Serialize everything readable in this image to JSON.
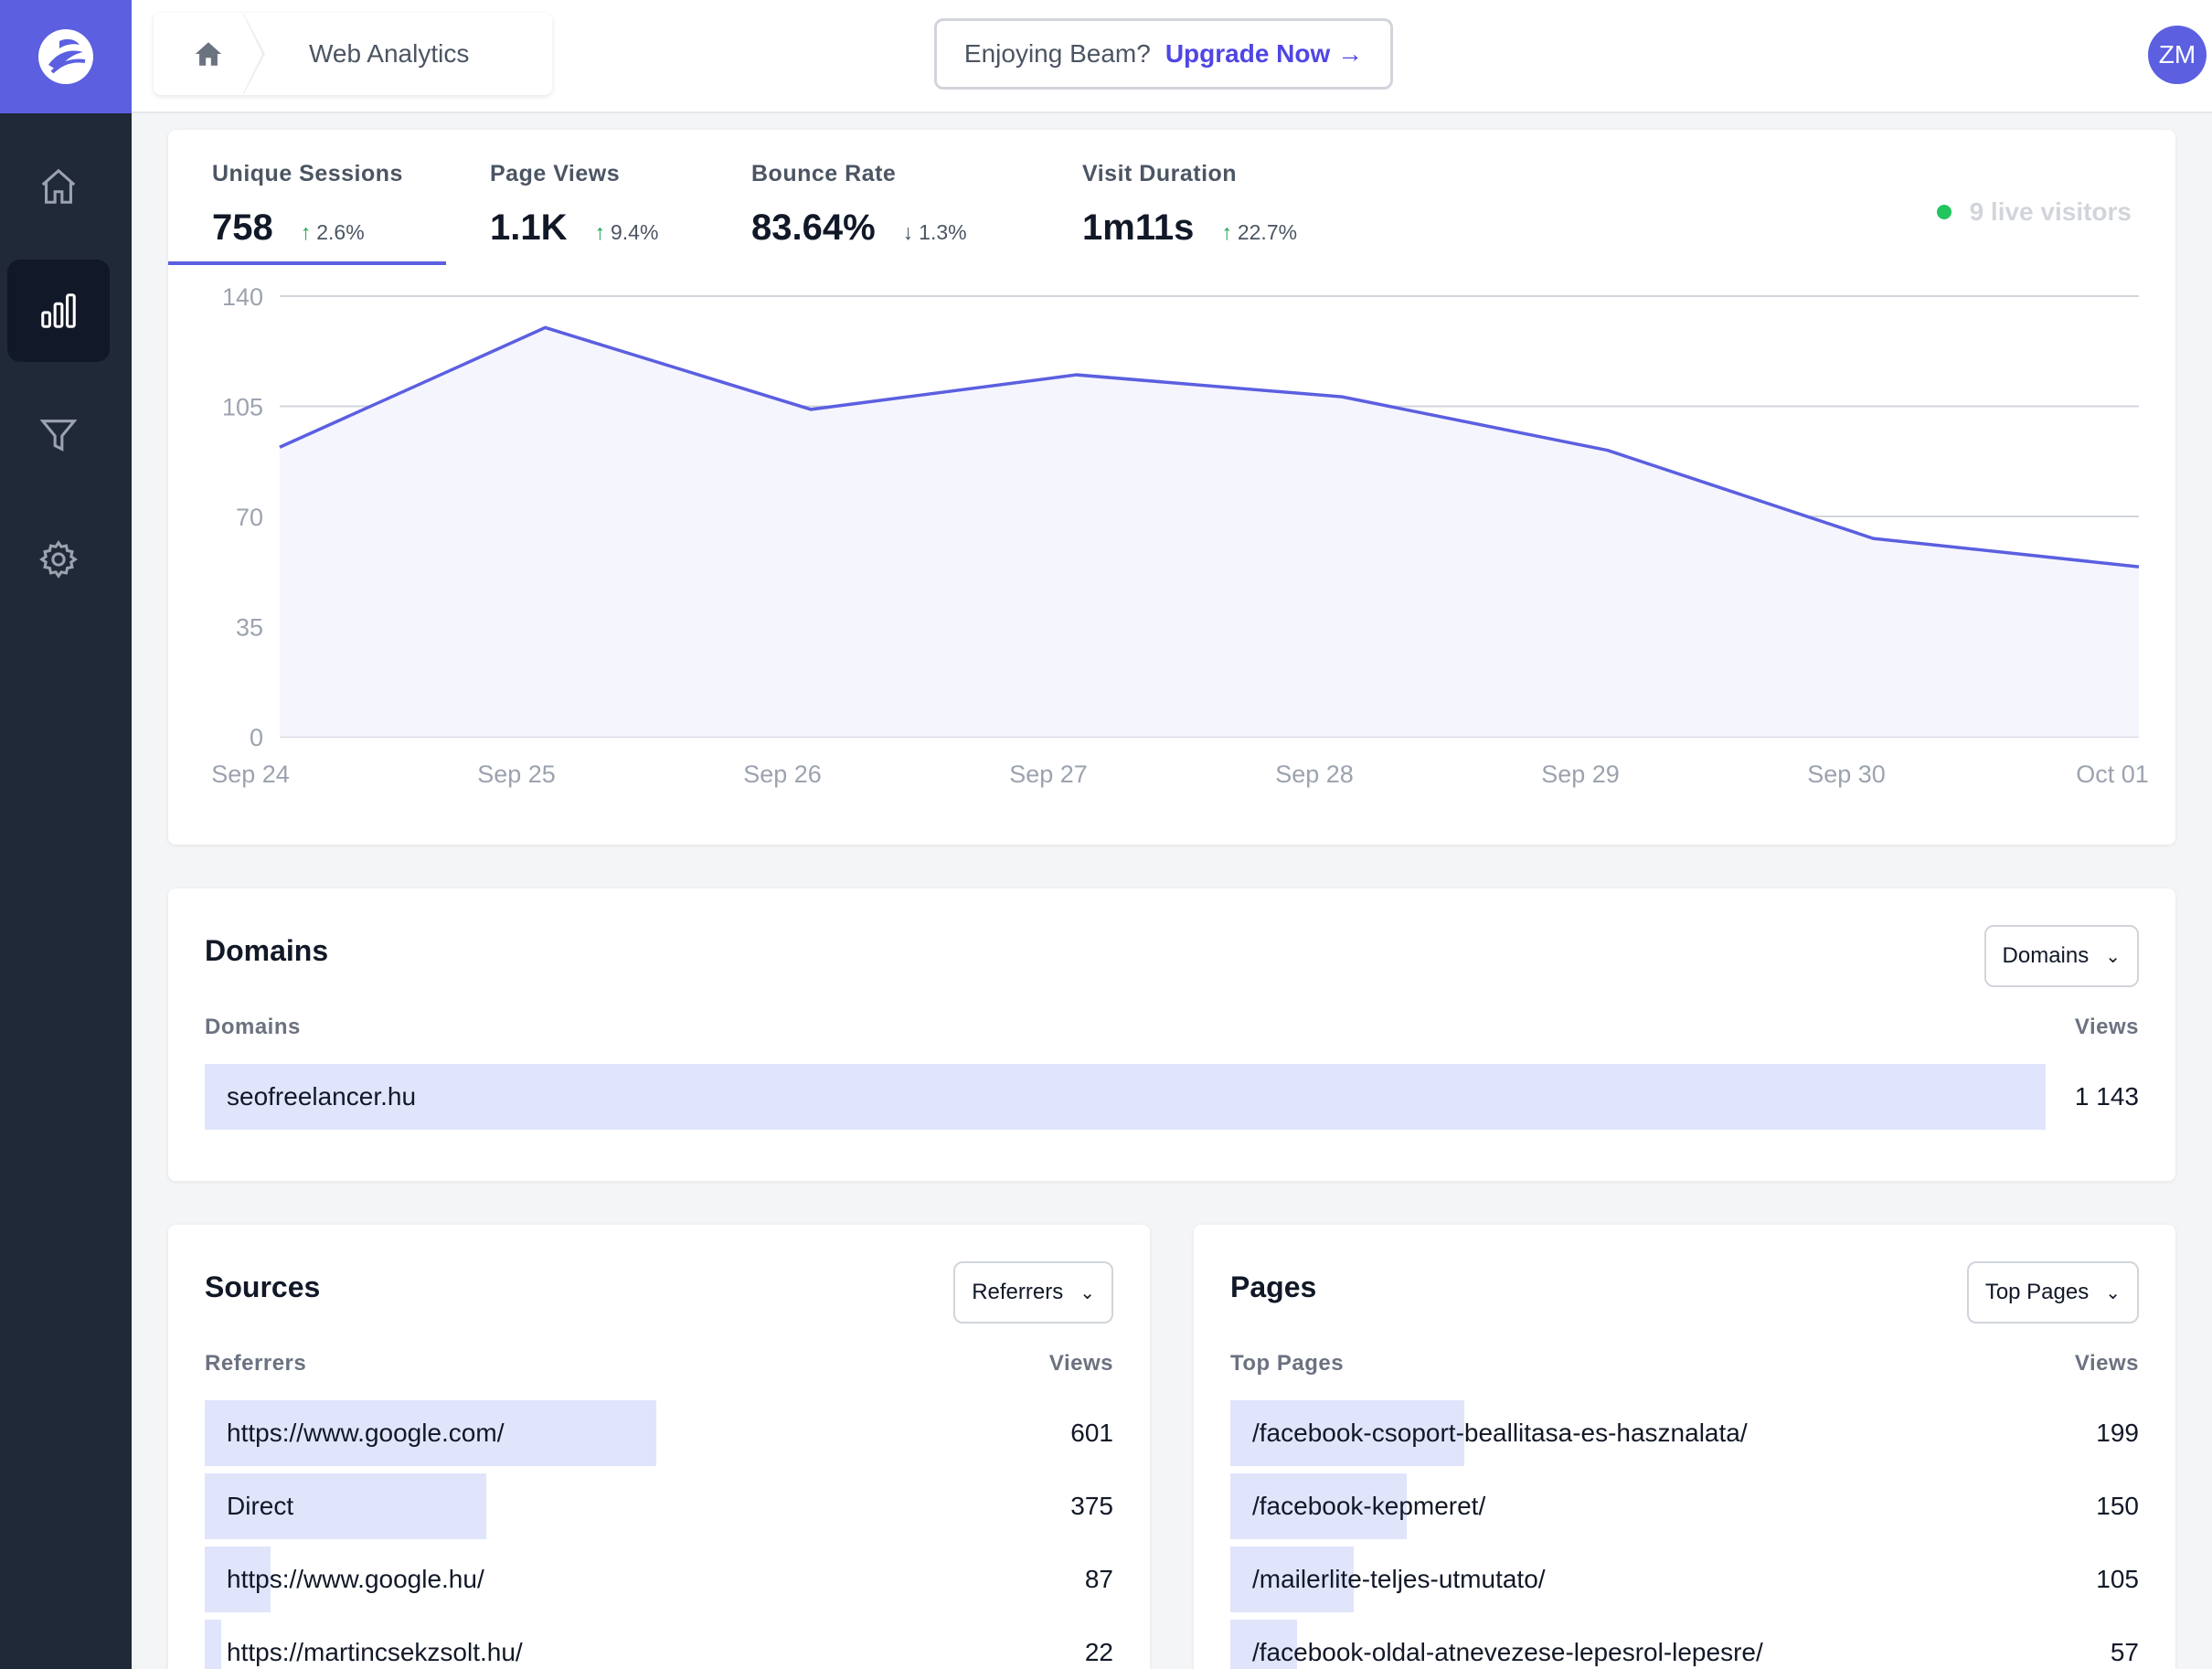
{
  "header": {
    "breadcrumb": "Web Analytics",
    "upgrade_question": "Enjoying Beam?",
    "upgrade_link": "Upgrade Now →",
    "avatar_initials": "ZM"
  },
  "stats": [
    {
      "label": "Unique Sessions",
      "value": "758",
      "change": "2.6%",
      "direction": "up"
    },
    {
      "label": "Page Views",
      "value": "1.1K",
      "change": "9.4%",
      "direction": "up"
    },
    {
      "label": "Bounce Rate",
      "value": "83.64%",
      "change": "1.3%",
      "direction": "down"
    },
    {
      "label": "Visit Duration",
      "value": "1m11s",
      "change": "22.7%",
      "direction": "up"
    }
  ],
  "live_visitors": "9 live visitors",
  "chart_data": {
    "type": "area",
    "x": [
      "Sep 24",
      "Sep 25",
      "Sep 26",
      "Sep 27",
      "Sep 28",
      "Sep 29",
      "Sep 30",
      "Oct 01"
    ],
    "y_ticks": [
      "140",
      "105",
      "70",
      "35",
      "0"
    ],
    "ylim": [
      0,
      140
    ],
    "series": [
      {
        "values": [
          92,
          130,
          104,
          115,
          108,
          91,
          63,
          54
        ]
      }
    ],
    "line_color": "#5b5fe0",
    "fill_color": "#f5f5fd",
    "grid": true
  },
  "domains": {
    "title": "Domains",
    "dropdown": "Domains",
    "col_label": "Domains",
    "col_value": "Views",
    "rows": [
      {
        "label": "seofreelancer.hu",
        "value": "1 143",
        "share": 1.0
      }
    ]
  },
  "sources": {
    "title": "Sources",
    "dropdown": "Referrers",
    "col_label": "Referrers",
    "col_value": "Views",
    "rows": [
      {
        "label": "https://www.google.com/",
        "value": "601",
        "share": 1.0
      },
      {
        "label": "Direct",
        "value": "375",
        "share": 0.624
      },
      {
        "label": "https://www.google.hu/",
        "value": "87",
        "share": 0.145
      },
      {
        "label": "https://martincsekzsolt.hu/",
        "value": "22",
        "share": 0.037
      }
    ]
  },
  "pages": {
    "title": "Pages",
    "dropdown": "Top Pages",
    "col_label": "Top Pages",
    "col_value": "Views",
    "rows": [
      {
        "label": "/facebook-csoport-beallitasa-es-hasznalata/",
        "value": "199",
        "share": 1.0
      },
      {
        "label": "/facebook-kepmeret/",
        "value": "150",
        "share": 0.754
      },
      {
        "label": "/mailerlite-teljes-utmutato/",
        "value": "105",
        "share": 0.528
      },
      {
        "label": "/facebook-oldal-atnevezese-lepesrol-lepesre/",
        "value": "57",
        "share": 0.286
      }
    ]
  }
}
